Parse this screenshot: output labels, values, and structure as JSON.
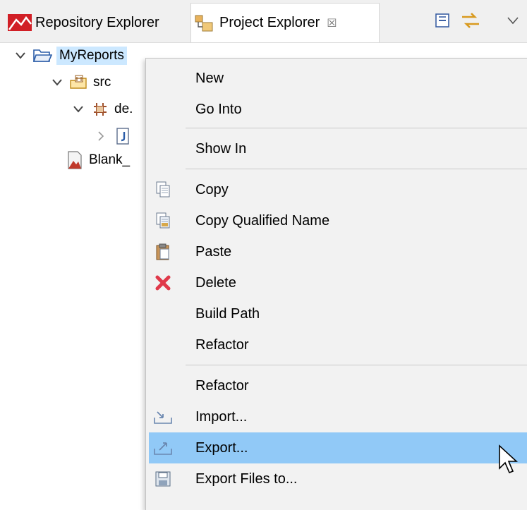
{
  "tabs": {
    "repository_explorer": "Repository Explorer",
    "project_explorer": "Project Explorer",
    "close_glyph": "☒"
  },
  "tree": {
    "project": "MyReports",
    "src": "src",
    "package": "de.",
    "blank": "Blank_"
  },
  "context_menu": {
    "items": [
      {
        "label": "New",
        "icon": ""
      },
      {
        "label": "Go Into",
        "icon": ""
      },
      {
        "label": "Show In",
        "icon": ""
      },
      {
        "label": "Copy",
        "icon": "copy-icon"
      },
      {
        "label": "Copy Qualified Name",
        "icon": "copy-qualified-name-icon"
      },
      {
        "label": "Paste",
        "icon": "paste-icon"
      },
      {
        "label": "Delete",
        "icon": "delete-icon"
      },
      {
        "label": "Build Path",
        "icon": ""
      },
      {
        "label": "Refactor",
        "icon": ""
      },
      {
        "label": "Refactor",
        "icon": ""
      },
      {
        "label": "Import...",
        "icon": "import-icon"
      },
      {
        "label": "Export...",
        "icon": "export-icon"
      },
      {
        "label": "Export Files to...",
        "icon": "save-icon"
      }
    ],
    "highlighted": "Export..."
  },
  "colors": {
    "highlight": "#91c9f7",
    "selection": "#cce8ff",
    "delete": "#e0394a"
  }
}
